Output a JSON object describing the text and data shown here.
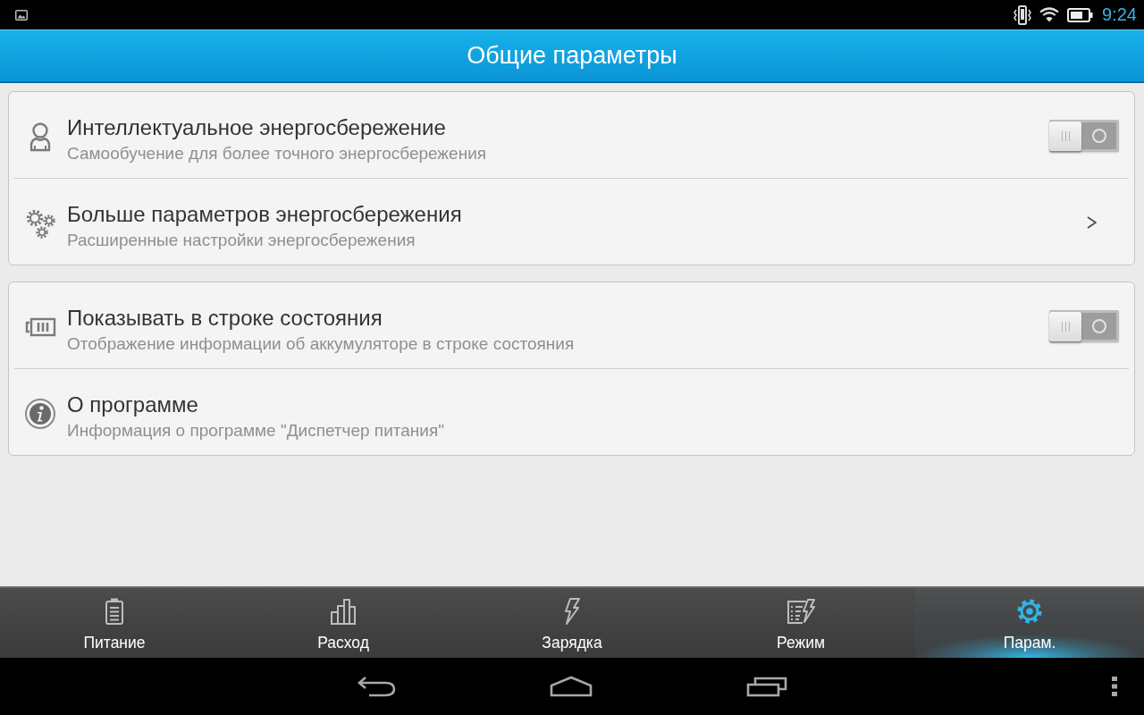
{
  "status_bar": {
    "time": "9:24"
  },
  "title_bar": {
    "title": "Общие параметры"
  },
  "groups": [
    {
      "items": [
        {
          "kind": "toggle",
          "title": "Интеллектуальное энергосбережение",
          "subtitle": "Самообучение для более точного энергосбережения",
          "on": false
        },
        {
          "kind": "link",
          "title": "Больше параметров энергосбережения",
          "subtitle": "Расширенные настройки энергосбережения"
        }
      ]
    },
    {
      "items": [
        {
          "kind": "toggle",
          "title": "Показывать в строке состояния",
          "subtitle": "Отображение информации об аккумуляторе в строке состояния",
          "on": false
        },
        {
          "kind": "plain",
          "title": "О программе",
          "subtitle": "Информация о программе \"Диспетчер питания\""
        }
      ]
    }
  ],
  "tab_bar": {
    "tabs": [
      {
        "label": "Питание",
        "selected": false
      },
      {
        "label": "Расход",
        "selected": false
      },
      {
        "label": "Зарядка",
        "selected": false
      },
      {
        "label": "Режим",
        "selected": false
      },
      {
        "label": "Парам.",
        "selected": true
      }
    ]
  }
}
